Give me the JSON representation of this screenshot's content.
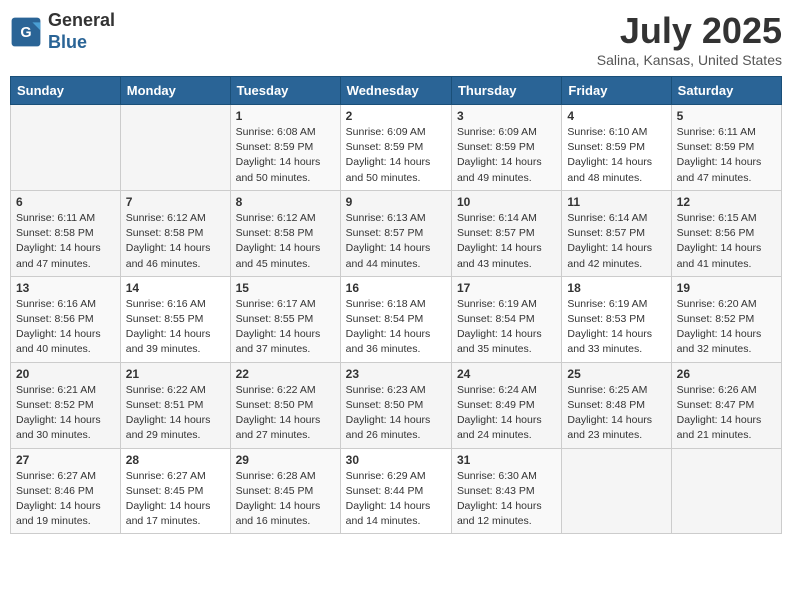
{
  "header": {
    "logo_line1": "General",
    "logo_line2": "Blue",
    "month_year": "July 2025",
    "location": "Salina, Kansas, United States"
  },
  "days_of_week": [
    "Sunday",
    "Monday",
    "Tuesday",
    "Wednesday",
    "Thursday",
    "Friday",
    "Saturday"
  ],
  "weeks": [
    [
      {
        "day": "",
        "info": ""
      },
      {
        "day": "",
        "info": ""
      },
      {
        "day": "1",
        "info": "Sunrise: 6:08 AM\nSunset: 8:59 PM\nDaylight: 14 hours\nand 50 minutes."
      },
      {
        "day": "2",
        "info": "Sunrise: 6:09 AM\nSunset: 8:59 PM\nDaylight: 14 hours\nand 50 minutes."
      },
      {
        "day": "3",
        "info": "Sunrise: 6:09 AM\nSunset: 8:59 PM\nDaylight: 14 hours\nand 49 minutes."
      },
      {
        "day": "4",
        "info": "Sunrise: 6:10 AM\nSunset: 8:59 PM\nDaylight: 14 hours\nand 48 minutes."
      },
      {
        "day": "5",
        "info": "Sunrise: 6:11 AM\nSunset: 8:59 PM\nDaylight: 14 hours\nand 47 minutes."
      }
    ],
    [
      {
        "day": "6",
        "info": "Sunrise: 6:11 AM\nSunset: 8:58 PM\nDaylight: 14 hours\nand 47 minutes."
      },
      {
        "day": "7",
        "info": "Sunrise: 6:12 AM\nSunset: 8:58 PM\nDaylight: 14 hours\nand 46 minutes."
      },
      {
        "day": "8",
        "info": "Sunrise: 6:12 AM\nSunset: 8:58 PM\nDaylight: 14 hours\nand 45 minutes."
      },
      {
        "day": "9",
        "info": "Sunrise: 6:13 AM\nSunset: 8:57 PM\nDaylight: 14 hours\nand 44 minutes."
      },
      {
        "day": "10",
        "info": "Sunrise: 6:14 AM\nSunset: 8:57 PM\nDaylight: 14 hours\nand 43 minutes."
      },
      {
        "day": "11",
        "info": "Sunrise: 6:14 AM\nSunset: 8:57 PM\nDaylight: 14 hours\nand 42 minutes."
      },
      {
        "day": "12",
        "info": "Sunrise: 6:15 AM\nSunset: 8:56 PM\nDaylight: 14 hours\nand 41 minutes."
      }
    ],
    [
      {
        "day": "13",
        "info": "Sunrise: 6:16 AM\nSunset: 8:56 PM\nDaylight: 14 hours\nand 40 minutes."
      },
      {
        "day": "14",
        "info": "Sunrise: 6:16 AM\nSunset: 8:55 PM\nDaylight: 14 hours\nand 39 minutes."
      },
      {
        "day": "15",
        "info": "Sunrise: 6:17 AM\nSunset: 8:55 PM\nDaylight: 14 hours\nand 37 minutes."
      },
      {
        "day": "16",
        "info": "Sunrise: 6:18 AM\nSunset: 8:54 PM\nDaylight: 14 hours\nand 36 minutes."
      },
      {
        "day": "17",
        "info": "Sunrise: 6:19 AM\nSunset: 8:54 PM\nDaylight: 14 hours\nand 35 minutes."
      },
      {
        "day": "18",
        "info": "Sunrise: 6:19 AM\nSunset: 8:53 PM\nDaylight: 14 hours\nand 33 minutes."
      },
      {
        "day": "19",
        "info": "Sunrise: 6:20 AM\nSunset: 8:52 PM\nDaylight: 14 hours\nand 32 minutes."
      }
    ],
    [
      {
        "day": "20",
        "info": "Sunrise: 6:21 AM\nSunset: 8:52 PM\nDaylight: 14 hours\nand 30 minutes."
      },
      {
        "day": "21",
        "info": "Sunrise: 6:22 AM\nSunset: 8:51 PM\nDaylight: 14 hours\nand 29 minutes."
      },
      {
        "day": "22",
        "info": "Sunrise: 6:22 AM\nSunset: 8:50 PM\nDaylight: 14 hours\nand 27 minutes."
      },
      {
        "day": "23",
        "info": "Sunrise: 6:23 AM\nSunset: 8:50 PM\nDaylight: 14 hours\nand 26 minutes."
      },
      {
        "day": "24",
        "info": "Sunrise: 6:24 AM\nSunset: 8:49 PM\nDaylight: 14 hours\nand 24 minutes."
      },
      {
        "day": "25",
        "info": "Sunrise: 6:25 AM\nSunset: 8:48 PM\nDaylight: 14 hours\nand 23 minutes."
      },
      {
        "day": "26",
        "info": "Sunrise: 6:26 AM\nSunset: 8:47 PM\nDaylight: 14 hours\nand 21 minutes."
      }
    ],
    [
      {
        "day": "27",
        "info": "Sunrise: 6:27 AM\nSunset: 8:46 PM\nDaylight: 14 hours\nand 19 minutes."
      },
      {
        "day": "28",
        "info": "Sunrise: 6:27 AM\nSunset: 8:45 PM\nDaylight: 14 hours\nand 17 minutes."
      },
      {
        "day": "29",
        "info": "Sunrise: 6:28 AM\nSunset: 8:45 PM\nDaylight: 14 hours\nand 16 minutes."
      },
      {
        "day": "30",
        "info": "Sunrise: 6:29 AM\nSunset: 8:44 PM\nDaylight: 14 hours\nand 14 minutes."
      },
      {
        "day": "31",
        "info": "Sunrise: 6:30 AM\nSunset: 8:43 PM\nDaylight: 14 hours\nand 12 minutes."
      },
      {
        "day": "",
        "info": ""
      },
      {
        "day": "",
        "info": ""
      }
    ]
  ]
}
